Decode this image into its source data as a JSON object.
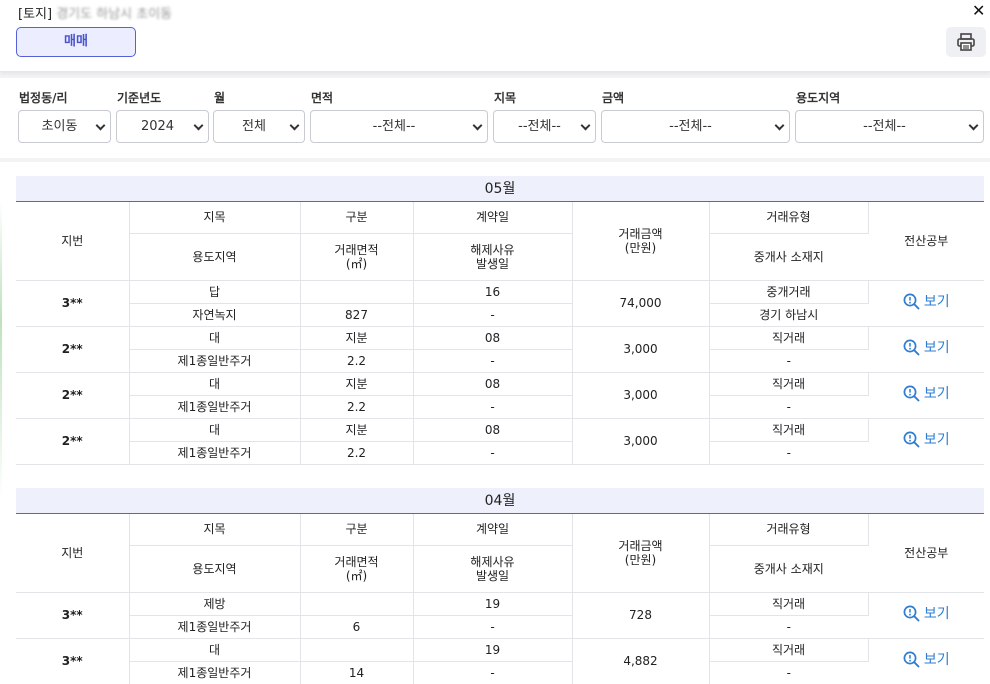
{
  "header": {
    "title_prefix": "[토지]",
    "title_blurred": "경기도 하남시 초이동",
    "close_icon": "close-icon",
    "tab_label": "매매",
    "print_icon": "print-icon"
  },
  "filters": [
    {
      "label": "법정동/리",
      "value": "초이동"
    },
    {
      "label": "기준년도",
      "value": "2024"
    },
    {
      "label": "월",
      "value": "전체"
    },
    {
      "label": "면적",
      "value": "--전체--"
    },
    {
      "label": "지목",
      "value": "--전체--"
    },
    {
      "label": "금액",
      "value": "--전체--"
    },
    {
      "label": "용도지역",
      "value": "--전체--"
    }
  ],
  "table_headers": {
    "jibun": "지번",
    "jimok": "지목",
    "yongdo": "용도지역",
    "gubun": "구분",
    "area": "거래면적\n(㎡)",
    "contract": "계약일",
    "cancel": "해제사유\n발생일",
    "price": "거래금액\n(만원)",
    "type": "거래유형",
    "agent": "중개사 소재지",
    "doc": "전산공부"
  },
  "view_label": "보기",
  "months": [
    {
      "label": "05월",
      "rows": [
        {
          "jibun": "3**",
          "jimok": "답",
          "gubun": "",
          "contract": "16",
          "price": "74,000",
          "type": "중개거래",
          "yongdo": "자연녹지",
          "area": "827",
          "cancel": "-",
          "agent": "경기 하남시"
        },
        {
          "jibun": "2**",
          "jimok": "대",
          "gubun": "지분",
          "contract": "08",
          "price": "3,000",
          "type": "직거래",
          "yongdo": "제1종일반주거",
          "area": "2.2",
          "cancel": "-",
          "agent": "-"
        },
        {
          "jibun": "2**",
          "jimok": "대",
          "gubun": "지분",
          "contract": "08",
          "price": "3,000",
          "type": "직거래",
          "yongdo": "제1종일반주거",
          "area": "2.2",
          "cancel": "-",
          "agent": "-"
        },
        {
          "jibun": "2**",
          "jimok": "대",
          "gubun": "지분",
          "contract": "08",
          "price": "3,000",
          "type": "직거래",
          "yongdo": "제1종일반주거",
          "area": "2.2",
          "cancel": "-",
          "agent": "-"
        }
      ]
    },
    {
      "label": "04월",
      "rows": [
        {
          "jibun": "3**",
          "jimok": "제방",
          "gubun": "",
          "contract": "19",
          "price": "728",
          "type": "직거래",
          "yongdo": "제1종일반주거",
          "area": "6",
          "cancel": "-",
          "agent": "-"
        },
        {
          "jibun": "3**",
          "jimok": "대",
          "gubun": "",
          "contract": "19",
          "price": "4,882",
          "type": "직거래",
          "yongdo": "제1종일반주거",
          "area": "14",
          "cancel": "-",
          "agent": "-"
        }
      ]
    }
  ],
  "colors": {
    "accent": "#5561d8",
    "link": "#2f7dd1",
    "month_bg": "#eef0fb"
  }
}
